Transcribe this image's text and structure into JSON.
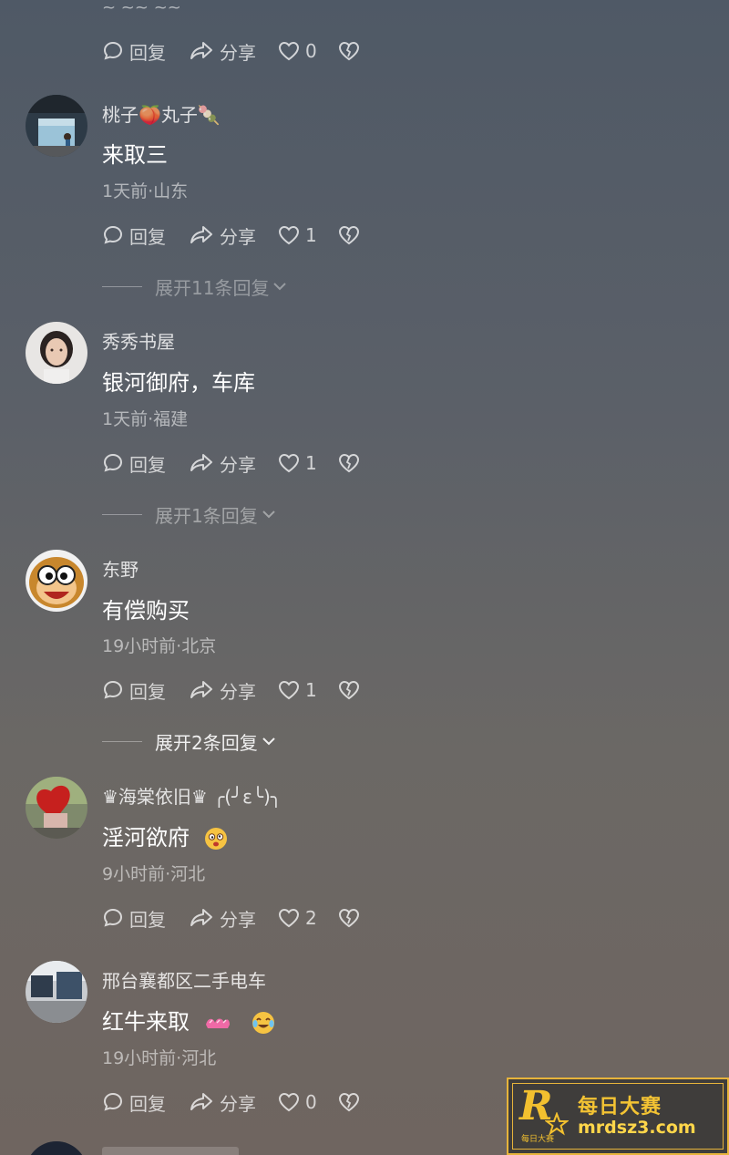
{
  "top_clipped_text": "~ ~~ ~~",
  "actions_labels": {
    "reply": "回复",
    "share": "分享"
  },
  "top_action_row": {
    "like_count": "0"
  },
  "comments": [
    {
      "username": "桃子🍑丸子🍡",
      "text": "来取三",
      "meta": "1天前·山东",
      "like_count": "1",
      "expand": "展开11条回复"
    },
    {
      "username": "秀秀书屋",
      "text": "银河御府，车库",
      "meta": "1天前·福建",
      "like_count": "1",
      "expand": "展开1条回复"
    },
    {
      "username": "东野",
      "text": "有偿购买",
      "meta": "19小时前·北京",
      "like_count": "1",
      "expand": "展开2条回复"
    },
    {
      "username": "♛海棠依旧♛ ╭(╯ε╰)╮",
      "text": "淫河欲府",
      "meta": "9小时前·河北",
      "like_count": "2"
    },
    {
      "username": "邢台襄都区二手电车",
      "text": "红牛来取",
      "meta": "19小时前·河北",
      "like_count": "0"
    }
  ],
  "watermark": {
    "letter": "R",
    "name": "每日大赛",
    "url": "mrdsz3.com",
    "small": "每日大赛"
  },
  "colors": {
    "accent_gold": "#e7b43b",
    "muted_text": "#9aa0a8"
  }
}
